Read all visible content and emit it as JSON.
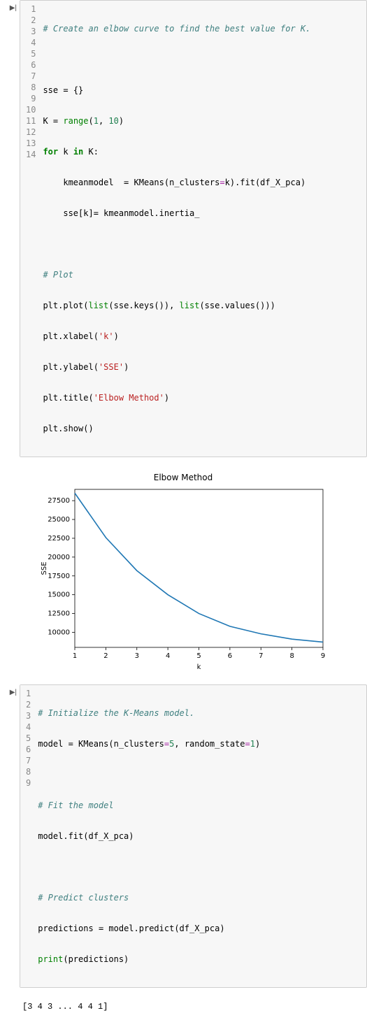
{
  "cell1": {
    "prompt": "▶|",
    "lines": [
      "1",
      "2",
      "3",
      "4",
      "5",
      "6",
      "7",
      "8",
      "9",
      "10",
      "11",
      "12",
      "13",
      "14"
    ],
    "code": {
      "l1_comment": "# Create an elbow curve to find the best value for K.",
      "l3_a": "sse",
      "l3_b": " = {}",
      "l4_a": "K",
      "l4_eq": " = ",
      "l4_fn": "range",
      "l4_args_open": "(",
      "l4_n1": "1",
      "l4_comma": ", ",
      "l4_n2": "10",
      "l4_close": ")",
      "l5_for": "for",
      "l5_sp1": " k ",
      "l5_in": "in",
      "l5_sp2": " K:",
      "l6_indent": "    ",
      "l6_a": "kmeanmodel",
      "l6_eq": "  = ",
      "l6_fn": "KMeans",
      "l6_open": "(",
      "l6_p": "n_clusters",
      "l6_peq": "=",
      "l6_pv": "k",
      "l6_close": ")",
      "l6_dot": ".fit(df_X_pca)",
      "l7_indent": "    ",
      "l7_a": "sse[k]",
      "l7_eq": "= ",
      "l7_b": "kmeanmodel.inertia_",
      "l9_comment": "# Plot",
      "l10": "plt.plot(",
      "l10_fn1": "list",
      "l10_a1": "(sse.keys()), ",
      "l10_fn2": "list",
      "l10_a2": "(sse.values()))",
      "l11_a": "plt.xlabel(",
      "l11_s": "'k'",
      "l11_c": ")",
      "l12_a": "plt.ylabel(",
      "l12_s": "'SSE'",
      "l12_c": ")",
      "l13_a": "plt.title(",
      "l13_s": "'Elbow Method'",
      "l13_c": ")",
      "l14": "plt.show()"
    }
  },
  "chart_data": {
    "type": "line",
    "title": "Elbow Method",
    "xlabel": "k",
    "ylabel": "SSE",
    "x": [
      1,
      2,
      3,
      4,
      5,
      6,
      7,
      8,
      9
    ],
    "y": [
      28500,
      22600,
      18200,
      15000,
      12500,
      10800,
      9800,
      9100,
      8700
    ],
    "xlim": [
      1,
      9
    ],
    "ylim": [
      8000,
      29000
    ],
    "yticks": [
      10000,
      12500,
      15000,
      17500,
      20000,
      22500,
      25000,
      27500
    ],
    "xticks": [
      1,
      2,
      3,
      4,
      5,
      6,
      7,
      8,
      9
    ]
  },
  "cell2": {
    "prompt": "▶|",
    "lines": [
      "1",
      "2",
      "3",
      "4",
      "5",
      "6",
      "7",
      "8",
      "9"
    ],
    "code": {
      "l1_comment": "# Initialize the K-Means model.",
      "l2_a": "model",
      "l2_eq": " = ",
      "l2_fn": "KMeans",
      "l2_open": "(",
      "l2_p1": "n_clusters",
      "l2_pe1": "=",
      "l2_v1": "5",
      "l2_comma": ", ",
      "l2_p2": "random_state",
      "l2_pe2": "=",
      "l2_v2": "1",
      "l2_close": ")",
      "l4_comment": "# Fit the model",
      "l5": "model.fit(df_X_pca)",
      "l7_comment": "# Predict clusters",
      "l8_a": "predictions",
      "l8_eq": " = ",
      "l8_b": "model.predict(df_X_pca)",
      "l9_fn": "print",
      "l9_args": "(predictions)"
    }
  },
  "output2": "[3 4 3 ... 4 4 1]"
}
